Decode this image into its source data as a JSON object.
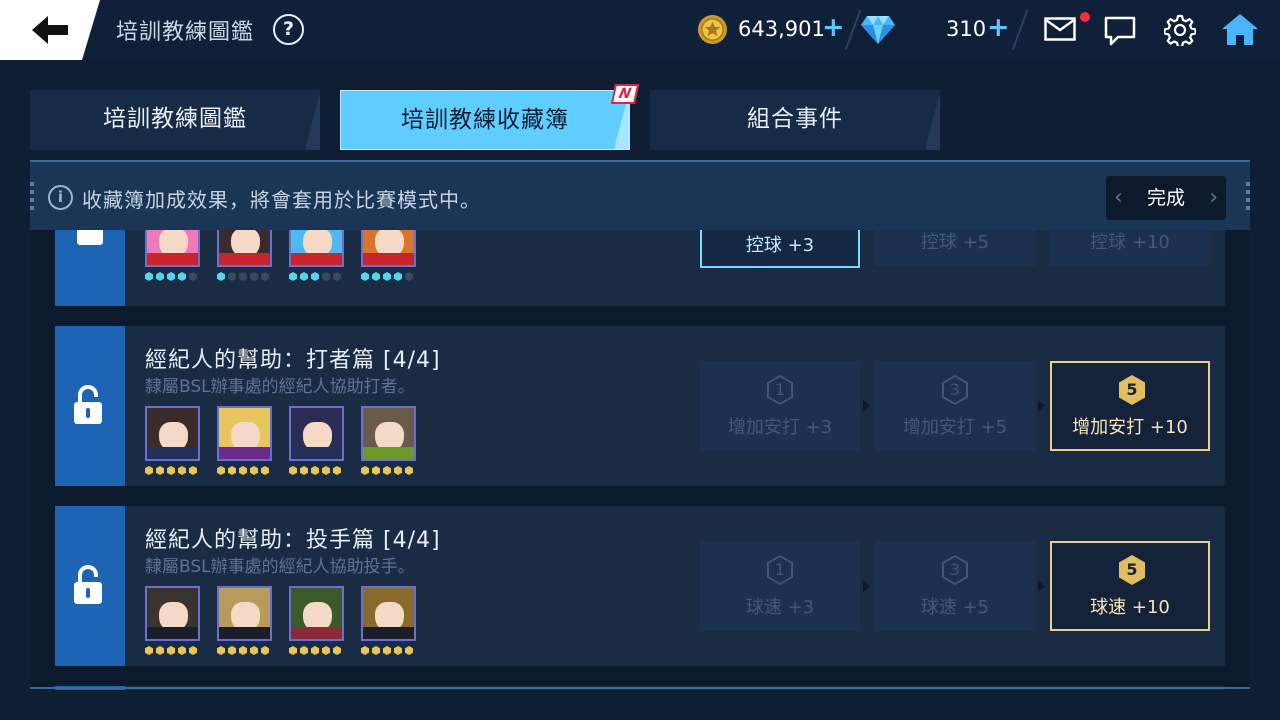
{
  "header": {
    "title": "培訓教練圖鑑",
    "help": "?",
    "coins": "643,901",
    "gems": "310",
    "plus": "+"
  },
  "tabs": [
    {
      "label": "培訓教練圖鑑"
    },
    {
      "label": "培訓教練收藏簿",
      "badge": "N"
    },
    {
      "label": "組合事件"
    }
  ],
  "info": {
    "icon": "i",
    "text": "收藏簿加成效果，將會套用於比賽模式中。",
    "done_label": "完成",
    "prev": "‹",
    "next": "›"
  },
  "rows": [
    {
      "title": "",
      "bonuses": [
        {
          "label": "控球 +3"
        },
        {
          "label": "控球 +5"
        },
        {
          "label": "控球 +10"
        }
      ]
    },
    {
      "title": "經紀人的幫助：打者篇 [4/4]",
      "desc": "隸屬BSL辦事處的經紀人協助打者。",
      "bonuses": [
        {
          "level": "1",
          "label": "增加安打 +3"
        },
        {
          "level": "3",
          "label": "增加安打 +5"
        },
        {
          "level": "5",
          "label": "增加安打 +10"
        }
      ]
    },
    {
      "title": "經紀人的幫助：投手篇 [4/4]",
      "desc": "隸屬BSL辦事處的經紀人協助投手。",
      "bonuses": [
        {
          "level": "1",
          "label": "球速 +3"
        },
        {
          "level": "3",
          "label": "球速 +5"
        },
        {
          "level": "5",
          "label": "球速 +10"
        }
      ]
    }
  ],
  "colors": {
    "accent": "#5fcdff",
    "gold": "#e9d283",
    "lock": "#1d64b4"
  }
}
